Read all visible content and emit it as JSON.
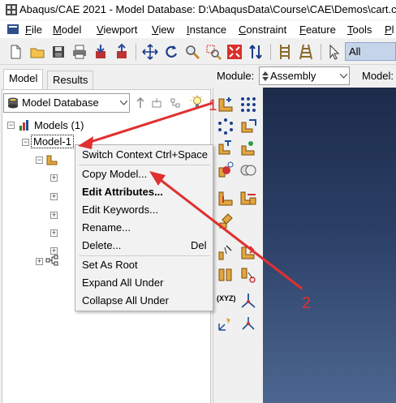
{
  "window": {
    "title": "Abaqus/CAE 2021 - Model Database: D:\\AbaqusData\\Course\\CAE\\Demos\\cart.c"
  },
  "menubar": {
    "items": [
      "File",
      "Model",
      "Viewport",
      "View",
      "Instance",
      "Constraint",
      "Feature",
      "Tools",
      "Pl"
    ],
    "mnemonics": [
      "F",
      "M",
      "V",
      "V",
      "I",
      "C",
      "F",
      "T",
      "P"
    ]
  },
  "toolbar": {
    "selection_filter": "All"
  },
  "tabs": {
    "model": "Model",
    "results": "Results"
  },
  "tree_selector": {
    "value": "Model Database"
  },
  "module_bar": {
    "module_label": "Module:",
    "module_value": "Assembly",
    "model_label": "Model:"
  },
  "tree": {
    "root": "Models (1)",
    "model": "Model-1"
  },
  "context_menu": {
    "items": [
      {
        "label": "Switch Context Ctrl+Space",
        "shortcut": ""
      },
      {
        "label": "Copy Model...",
        "shortcut": ""
      },
      {
        "label": "Edit Attributes...",
        "shortcut": "",
        "bold": true
      },
      {
        "label": "Edit Keywords...",
        "shortcut": ""
      },
      {
        "label": "Rename...",
        "shortcut": ""
      },
      {
        "label": "Delete...",
        "shortcut": "Del"
      },
      {
        "label": "Set As Root",
        "shortcut": ""
      },
      {
        "label": "Expand All Under",
        "shortcut": ""
      },
      {
        "label": "Collapse All Under",
        "shortcut": ""
      }
    ]
  },
  "annotations": {
    "one": "1",
    "two": "2",
    "color": "#e03030"
  },
  "colors": {
    "viewport_top": "#1c2b4a",
    "viewport_bottom": "#4c6790",
    "selection_box": "#c6d4ea"
  }
}
